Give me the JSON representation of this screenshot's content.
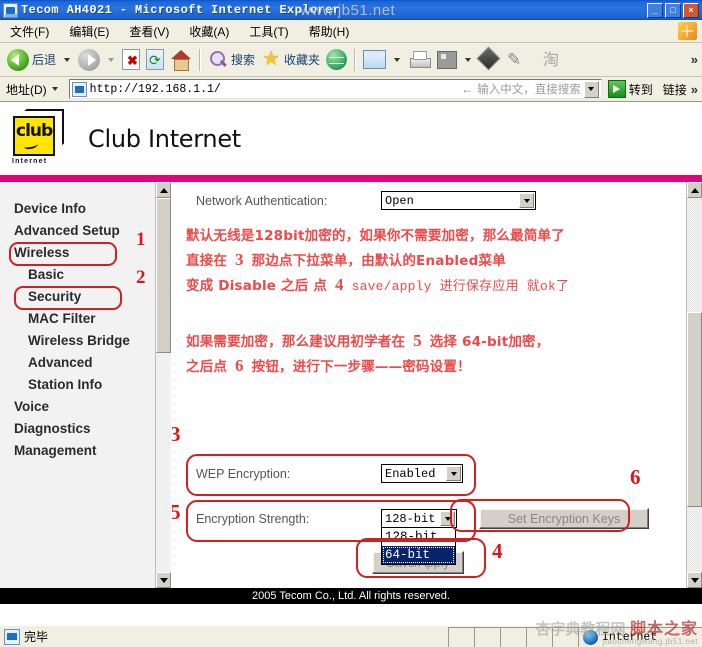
{
  "window": {
    "title": "Tecom AH4021 - Microsoft Internet Explorer",
    "minimize": "_",
    "maximize": "□",
    "close": "×"
  },
  "menu": [
    {
      "label": "文件(F)"
    },
    {
      "label": "编辑(E)"
    },
    {
      "label": "查看(V)"
    },
    {
      "label": "收藏(A)"
    },
    {
      "label": "工具(T)"
    },
    {
      "label": "帮助(H)"
    }
  ],
  "toolbar": {
    "back_label": "后退",
    "search_label": "搜索",
    "favorites_label": "收藏夹",
    "overflow": "»",
    "icons": [
      "back-icon",
      "forward-icon",
      "stop-icon",
      "refresh-icon",
      "home-icon",
      "search-icon",
      "favorites-icon",
      "history-icon",
      "mail-icon",
      "print-icon",
      "edit-icon",
      "messenger-icon",
      "swoosh-icon",
      "taobao-icon"
    ]
  },
  "address": {
    "label": "地址(D)",
    "url": "http://192.168.1.1/",
    "hint": "输入中文，直接搜索",
    "go_label": "转到",
    "links_label": "链接",
    "overflow": "»"
  },
  "brand": {
    "logo_text": "club",
    "logo_sub": "Internet",
    "name": "Club Internet",
    "accent_color": "#e5007d",
    "logo_color": "#ffe500"
  },
  "sidebar": {
    "items": [
      {
        "label": "Device Info",
        "indent": false,
        "highlighted": false
      },
      {
        "label": "Advanced Setup",
        "indent": false,
        "highlighted": false
      },
      {
        "label": "Wireless",
        "indent": false,
        "highlighted": true
      },
      {
        "label": "Basic",
        "indent": true,
        "highlighted": false
      },
      {
        "label": "Security",
        "indent": true,
        "highlighted": true
      },
      {
        "label": "MAC Filter",
        "indent": true,
        "highlighted": false
      },
      {
        "label": "Wireless Bridge",
        "indent": true,
        "highlighted": false
      },
      {
        "label": "Advanced",
        "indent": true,
        "highlighted": false
      },
      {
        "label": "Station Info",
        "indent": true,
        "highlighted": false
      },
      {
        "label": "Voice",
        "indent": false,
        "highlighted": false
      },
      {
        "label": "Diagnostics",
        "indent": false,
        "highlighted": false
      },
      {
        "label": "Management",
        "indent": false,
        "highlighted": false
      }
    ],
    "callout_1": "1",
    "callout_2": "2"
  },
  "form": {
    "network_auth_label": "Network Authentication:",
    "network_auth_value": "Open",
    "wep_label": "WEP Encryption:",
    "wep_value": "Enabled",
    "strength_label": "Encryption Strength:",
    "strength_value": "128-bit",
    "strength_options": [
      "128-bit",
      "64-bit"
    ],
    "strength_selected_option": "64-bit",
    "set_keys_label": "Set Encryption Keys",
    "save_label": "Save/Apply"
  },
  "annotations": {
    "line1": "默认无线是128bit加密的，如果你不需要加密，那么最简单了",
    "line2_a": "直接在",
    "line2_num": "3",
    "line2_b": "那边点下拉菜单，由默认的Enabled菜单",
    "line3_a": "变成 Disable 之后",
    "line3_b": "点",
    "line3_num": "4",
    "line3_c": "save/apply 进行保存应用 就ok了",
    "line4_a": "如果需要加密，那么建议用初学者在",
    "line4_num": "5",
    "line4_b": "选择 64-bit加密，",
    "line5_a": "之后点",
    "line5_num": "6",
    "line5_b": "按钮，进行下一步骤——密码设置！",
    "callout_3": "3",
    "callout_4": "4",
    "callout_5": "5",
    "callout_6": "6",
    "highlight_color": "#d02020",
    "text_color": "#f04848"
  },
  "footer": {
    "copyright": "2005 Tecom Co., Ltd. All rights reserved."
  },
  "statusbar": {
    "status": "完毕",
    "zone": "Internet"
  },
  "watermarks": {
    "top": "www.jb51.net",
    "bottom_cn": "脚本之家",
    "bottom_cn2": "杏字典教程网",
    "bottom_en": "jiaochengwang.jb51.net"
  }
}
